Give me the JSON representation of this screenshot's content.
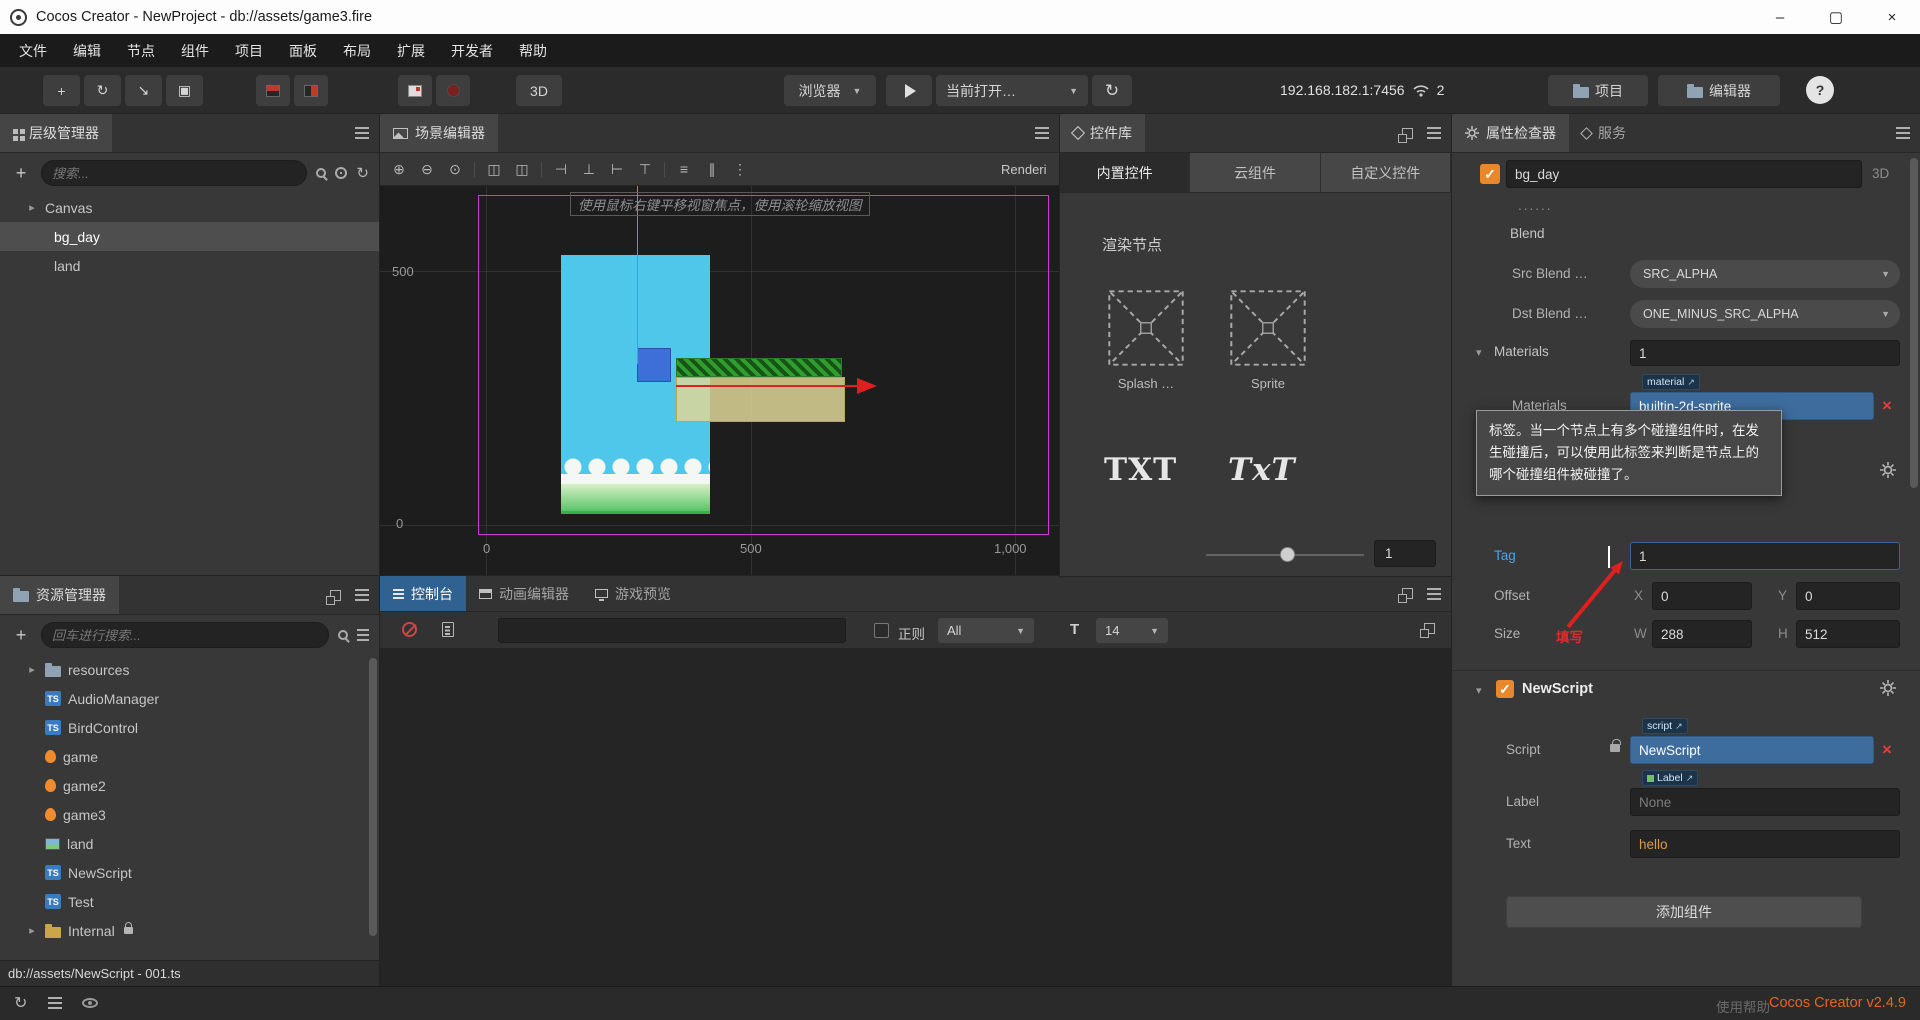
{
  "window": {
    "title": "Cocos Creator - NewProject - db://assets/game3.fire",
    "minimize": "–",
    "maximize": "▢",
    "close": "×"
  },
  "menubar": {
    "items": [
      "文件",
      "编辑",
      "节点",
      "组件",
      "项目",
      "面板",
      "布局",
      "扩展",
      "开发者",
      "帮助"
    ]
  },
  "toolbar": {
    "tools": [
      "+",
      "↻",
      "↘",
      "▣"
    ],
    "mode_3d": "3D",
    "browser": "浏览器",
    "current_open": "当前打开…",
    "refresh": "↻",
    "address": "192.168.182.1:7456",
    "connections": "2",
    "project": "项目",
    "editor": "编辑器",
    "help": "?"
  },
  "icons": {
    "check": "✓",
    "caret_down": "▾",
    "caret_right": "▸",
    "dropdown": "▼",
    "link": "↗"
  },
  "hierarchy": {
    "title": "层级管理器",
    "search_placeholder": "搜索...",
    "items": [
      {
        "label": "Canvas"
      },
      {
        "label": "bg_day"
      },
      {
        "label": "land"
      }
    ]
  },
  "assets": {
    "title": "资源管理器",
    "search_placeholder": "回车进行搜索...",
    "ts_badge": "TS",
    "items": [
      {
        "label": "resources"
      },
      {
        "label": "AudioManager"
      },
      {
        "label": "BirdControl"
      },
      {
        "label": "game"
      },
      {
        "label": "game2"
      },
      {
        "label": "game3"
      },
      {
        "label": "land"
      },
      {
        "label": "NewScript"
      },
      {
        "label": "Test"
      },
      {
        "label": "Internal"
      }
    ],
    "status": "db://assets/NewScript - 001.ts"
  },
  "scene": {
    "title": "场景编辑器",
    "tools": [
      "⊕",
      "⊖",
      "⊙",
      "◫",
      "◫",
      "⊣",
      "⊥",
      "⊢",
      "⊤",
      "≡",
      "∥",
      "⋮"
    ],
    "render_clip": "Renderi",
    "hint": "使用鼠标右键平移视窗焦点，使用滚轮缩放视图",
    "ruler_left_top": "500",
    "ruler_left_bottom": "0",
    "ruler_bottom": [
      "0",
      "500",
      "1,000"
    ]
  },
  "console": {
    "tabs": [
      "控制台",
      "动画编辑器",
      "游戏预览"
    ],
    "regex_label": "正则",
    "filter_all": "All",
    "font_label": "T",
    "font_size": "14"
  },
  "widgets": {
    "title": "控件库",
    "tabs": [
      "内置控件",
      "云组件",
      "自定义控件"
    ],
    "section": "渲染节点",
    "item1": "Splash …",
    "item2": "Sprite",
    "text1": "TXT",
    "text2": "TxT",
    "zoom_value": "1"
  },
  "inspector": {
    "tab1": "属性检查器",
    "tab2": "服务",
    "node_name": "bg_day",
    "mode": "3D",
    "dots": "......",
    "blend_title": "Blend",
    "src_label": "Src Blend …",
    "src_value": "SRC_ALPHA",
    "dst_label": "Dst Blend …",
    "dst_value": "ONE_MINUS_SRC_ALPHA",
    "materials_label": "Materials",
    "materials_count": "1",
    "material_chip": "material",
    "material_value": "builtin-2d-sprite",
    "tooltip": "标签。当一个节点上有多个碰撞组件时，在发生碰撞后，可以使用此标签来判断是节点上的哪个碰撞组件被碰撞了。",
    "tag_label": "Tag",
    "tag_value": "1",
    "offset_label": "Offset",
    "x_label": "X",
    "offset_x": "0",
    "y_label": "Y",
    "offset_y": "0",
    "size_label": "Size",
    "annotation": "填写",
    "w_label": "W",
    "size_w": "288",
    "h_label": "H",
    "size_h": "512",
    "script_section": "NewScript",
    "script_chip": "script",
    "script_label": "Script",
    "script_value": "NewScript",
    "label_chip": "Label",
    "label_label": "Label",
    "label_value": "None",
    "text_label": "Text",
    "text_value": "hello",
    "add_component": "添加组件"
  },
  "statusbar": {
    "help_text": "使用帮助",
    "version": "Cocos Creator v2.4.9"
  }
}
